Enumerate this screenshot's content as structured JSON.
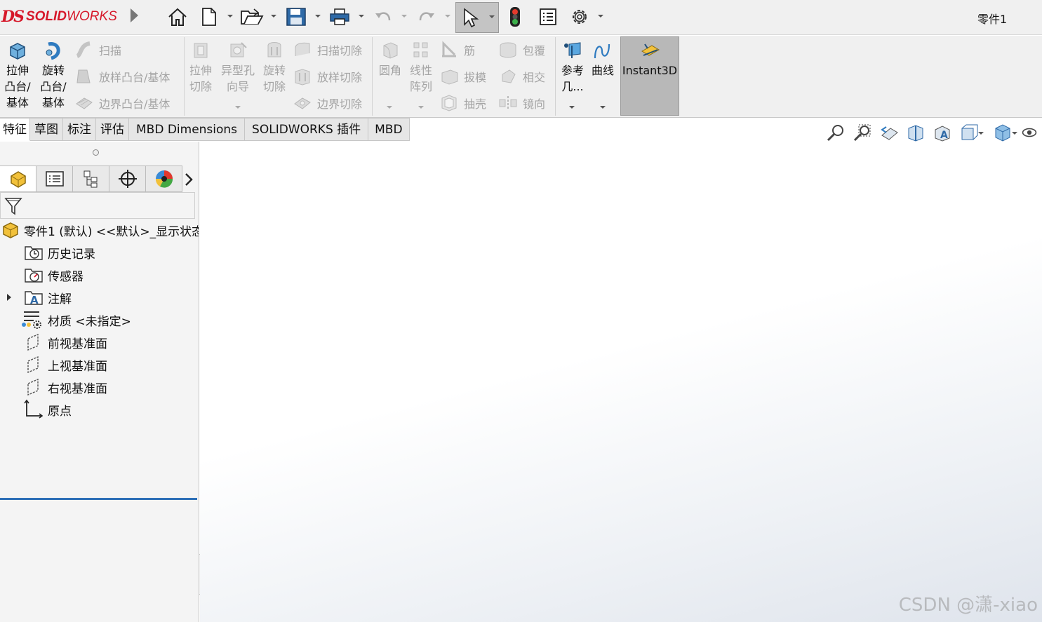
{
  "app": {
    "brand_ds": "DS",
    "brand_name_bold": "SOLID",
    "brand_name_rest": "WORKS",
    "document_title": "零件1"
  },
  "quick_access": [
    "home-icon",
    "new-document-icon",
    "open-icon",
    "save-icon",
    "print-icon",
    "undo-icon",
    "redo-icon",
    "select-pointer-icon",
    "rebuild-traffic-light-icon",
    "file-properties-icon",
    "options-gear-icon"
  ],
  "ribbon": {
    "extrude_boss": "拉伸\n凸台/\n基体",
    "revolve_boss": "旋转\n凸台/\n基体",
    "sweep": "扫描",
    "loft_boss": "放样凸台/基体",
    "boundary_boss": "边界凸台/基体",
    "extrude_cut": "拉伸\n切除",
    "hole_wizard": "异型孔\n向导",
    "revolve_cut": "旋转\n切除",
    "sweep_cut": "扫描切除",
    "loft_cut": "放样切除",
    "boundary_cut": "边界切除",
    "fillet": "圆角",
    "linear_pattern": "线性\n阵列",
    "rib": "筋",
    "draft": "拔模",
    "shell": "抽壳",
    "wrap": "包覆",
    "intersect": "相交",
    "mirror": "镜向",
    "reference_geometry": "参考\n几...",
    "curves": "曲线",
    "instant3d": "Instant3D"
  },
  "tabs": [
    "特征",
    "草图",
    "标注",
    "评估",
    "MBD Dimensions",
    "SOLIDWORKS 插件",
    "MBD"
  ],
  "active_tab": "特征",
  "view_tools": [
    "zoom-to-fit-icon",
    "zoom-to-area-icon",
    "previous-view-icon",
    "section-view-icon",
    "dynamic-annotation-icon",
    "view-orientation-icon",
    "display-style-icon",
    "hide-show-icon"
  ],
  "panel_tabs": [
    "feature-manager-icon",
    "property-manager-icon",
    "configuration-manager-icon",
    "dimxpert-manager-icon",
    "display-manager-icon"
  ],
  "tree": {
    "root": "零件1 (默认) <<默认>_显示状态",
    "items": [
      {
        "label": "历史记录",
        "icon": "history-icon"
      },
      {
        "label": "传感器",
        "icon": "sensor-icon"
      },
      {
        "label": "注解",
        "icon": "annotation-icon"
      },
      {
        "label": "材质 <未指定>",
        "icon": "material-icon"
      },
      {
        "label": "前视基准面",
        "icon": "plane-icon"
      },
      {
        "label": "上视基准面",
        "icon": "plane-icon"
      },
      {
        "label": "右视基准面",
        "icon": "plane-icon"
      },
      {
        "label": "原点",
        "icon": "origin-icon"
      }
    ]
  },
  "watermark": "CSDN @潇-xiao",
  "colors": {
    "brand_red": "#d6182a",
    "active_blue": "#2d6fb7",
    "toolbar_bg": "#f0f0f0"
  }
}
